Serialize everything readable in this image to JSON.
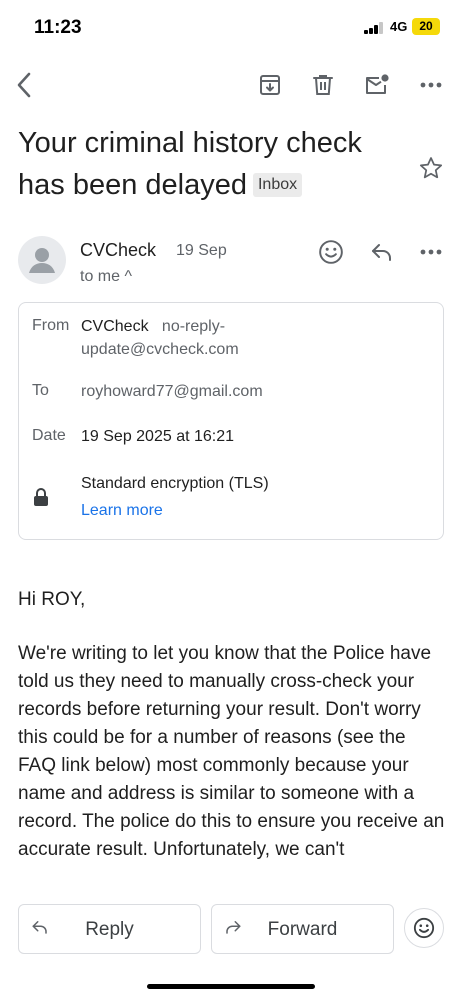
{
  "status_bar": {
    "time": "11:23",
    "network": "4G",
    "battery": "20"
  },
  "email": {
    "subject": "Your criminal history check has been delayed",
    "label": "Inbox",
    "sender": {
      "name": "CVCheck",
      "date": "19 Sep",
      "recipient": "to me ^"
    },
    "details": {
      "from_label": "From",
      "from_name": "CVCheck",
      "from_email": "no-reply-update@cvcheck.com",
      "to_label": "To",
      "to_email": "royhoward77@gmail.com",
      "date_label": "Date",
      "date_value": "19 Sep 2025 at 16:21",
      "security_text": "Standard encryption (TLS)",
      "learn_more": "Learn more"
    },
    "body": {
      "greeting": "Hi ROY,",
      "paragraph": "We're writing to let you know that the Police have told us they need to manually cross-check your records before returning your result. Don't worry this could be for a number of reasons (see the FAQ link below) most commonly because your name and address is similar to someone with a record. The police do this to ensure you receive an accurate result. Unfortunately, we can't"
    }
  },
  "actions": {
    "reply": "Reply",
    "forward": "Forward"
  },
  "icons": [
    "back-icon",
    "archive-icon",
    "trash-icon",
    "mark-unread-icon",
    "more-icon",
    "star-icon",
    "person-icon",
    "emoji-icon",
    "reply-icon",
    "forward-icon",
    "lock-icon"
  ]
}
